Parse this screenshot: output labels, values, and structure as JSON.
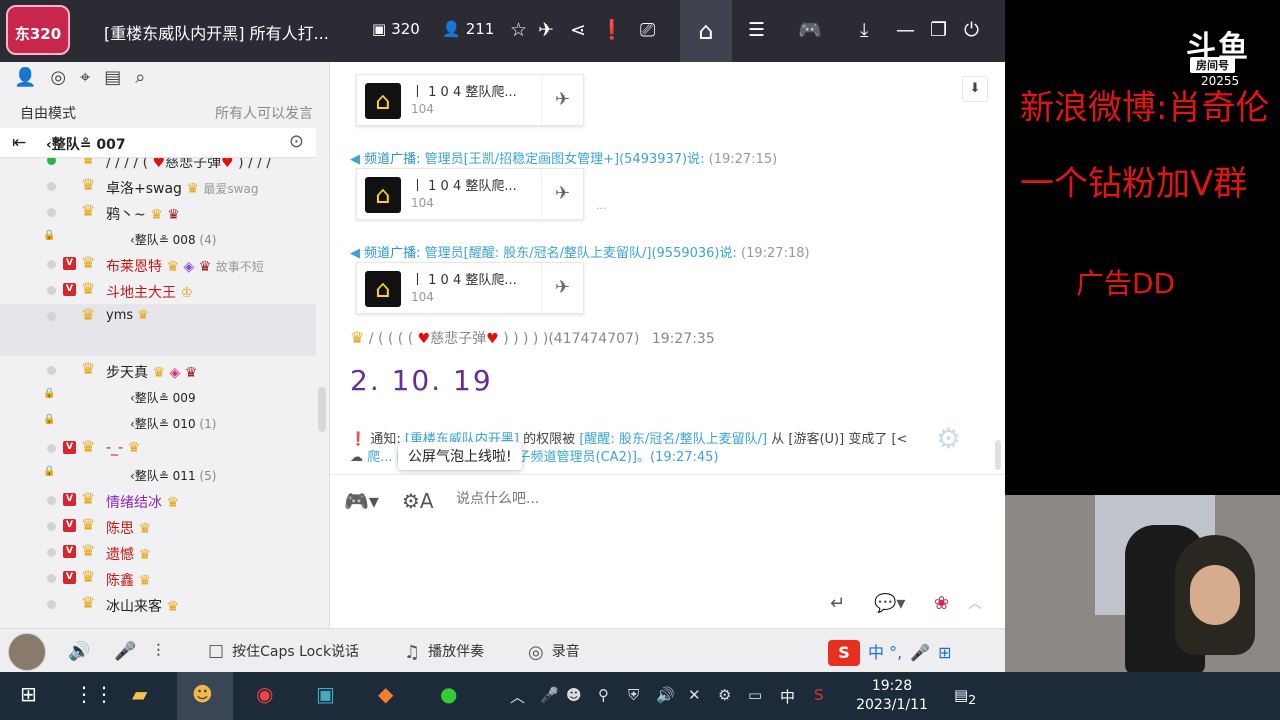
{
  "titlebar": {
    "logo_text": "东320",
    "room_title": "[重楼东威队内开黑] 所有人打...",
    "channel_count": "320",
    "online_count": "211"
  },
  "left": {
    "mode": "自由模式",
    "speak_status": "所有人可以发言",
    "current_channel": "‹整队≗ 007",
    "users": [
      {
        "name": "卓洛+swag",
        "sign": "最爱swag"
      },
      {
        "name": "鸦丶~"
      },
      {
        "subchannel": "‹整队≗ 008",
        "count": "(4)"
      },
      {
        "name": "布莱恩特",
        "sign": "故事不短"
      },
      {
        "name": "斗地主大王"
      },
      {
        "name": "yms"
      },
      {
        "name": "步天真"
      },
      {
        "subchannel": "‹整队≗ 009"
      },
      {
        "subchannel": "‹整队≗ 010",
        "count": "(1)"
      },
      {
        "name": "-_-"
      },
      {
        "subchannel": "‹整队≗ 011",
        "count": "(5)"
      },
      {
        "name": "情绪结冰"
      },
      {
        "name": "陈思"
      },
      {
        "name": "遗憾"
      },
      {
        "name": "陈鑫"
      },
      {
        "name": "冰山来客"
      }
    ]
  },
  "chat": {
    "card_title": "丨 1 0 4 整队爬...",
    "card_id": "104",
    "broadcast1": {
      "label": "频道广播:",
      "text": "管理员[王凯/招稳定画图女管理+](5493937)说:",
      "time": "(19:27:15)"
    },
    "broadcast2": {
      "label": "频道广播:",
      "text": "管理员[醒醒: 股东/冠名/整队上麦留队/](9559036)说:",
      "time": "(19:27:18)"
    },
    "msg_user": "慈悲子弹",
    "msg_uid": "(417474707)",
    "msg_time": "19:27:35",
    "msg_text": "2. 10. 19",
    "notice_label": "通知:",
    "notice_link1": "[重楼东威队内开黑]",
    "notice_mid": "的权限被",
    "notice_link2": "[醒醒: 股东/冠名/整队上麦留队/]",
    "notice_from": "从 [游客(U)] 变成了 [<",
    "notice2": "爬... 的权限被 ... 变成了 [子频道管理员(CA2)]。(19:27:45)",
    "toast": "公屏气泡上线啦!",
    "dots": "···"
  },
  "input": {
    "placeholder": "说点什么吧..."
  },
  "bottombar": {
    "caps": "按住Caps Lock说话",
    "accompany": "播放伴奏",
    "record": "录音"
  },
  "ime": {
    "s": "S",
    "chars": "中 °,"
  },
  "taskbar": {
    "time": "19:28",
    "date": "2023/1/11",
    "ime_lang": "中",
    "notif_count": "2"
  },
  "overlay": {
    "douyu": "斗鱼",
    "room_label": "房间号",
    "room_number": "20255",
    "weibo": "新浪微博:肖奇伦",
    "group": "一个钻粉加V群",
    "ad": "广告DD"
  }
}
